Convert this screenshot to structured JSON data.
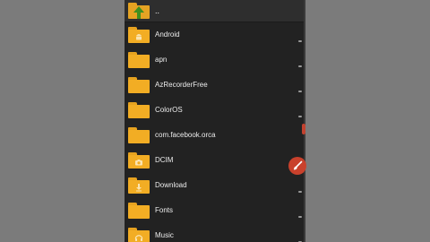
{
  "header": {
    "up_label": ".."
  },
  "files": [
    {
      "name": "Android",
      "icon": "android-icon"
    },
    {
      "name": "apn",
      "icon": ""
    },
    {
      "name": "AzRecorderFree",
      "icon": ""
    },
    {
      "name": "ColorOS",
      "icon": ""
    },
    {
      "name": "com.facebook.orca",
      "icon": ""
    },
    {
      "name": "DCIM",
      "icon": "camera-icon"
    },
    {
      "name": "Download",
      "icon": "download-icon"
    },
    {
      "name": "Fonts",
      "icon": ""
    },
    {
      "name": "Music",
      "icon": "headphones-icon"
    }
  ],
  "fab": {
    "icon": "brush-icon",
    "color": "#c9412c"
  },
  "colors": {
    "background": "#7b7b7b",
    "list_background": "#222222",
    "folder": "#f2ad24",
    "accent": "#c2422f"
  }
}
